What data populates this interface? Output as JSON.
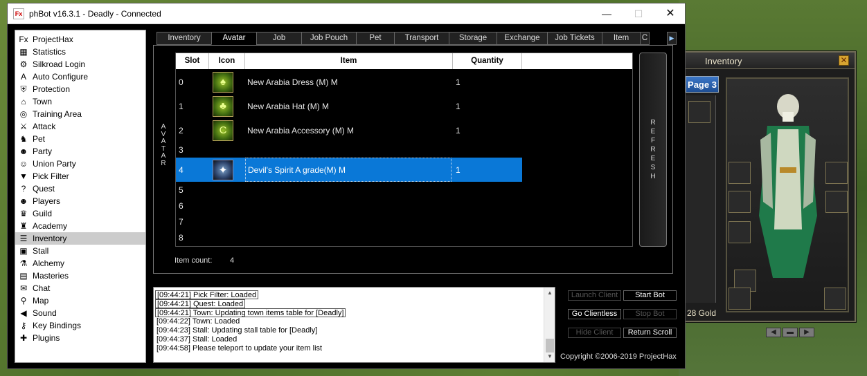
{
  "window": {
    "title": "phBot v16.3.1 - Deadly - Connected",
    "icon_text": "Fx",
    "minimize_label": "—",
    "maximize_label": "☐",
    "close_label": "✕"
  },
  "sidebar": {
    "items": [
      {
        "label": "ProjectHax",
        "icon": "projecthax-logo-icon",
        "glyph": "Fx"
      },
      {
        "label": "Statistics",
        "icon": "statistics-icon",
        "glyph": "▦"
      },
      {
        "label": "Silkroad Login",
        "icon": "login-icon",
        "glyph": "⚙"
      },
      {
        "label": "Auto Configure",
        "icon": "auto-configure-icon",
        "glyph": "A"
      },
      {
        "label": "Protection",
        "icon": "shield-icon",
        "glyph": "⛨"
      },
      {
        "label": "Town",
        "icon": "town-icon",
        "glyph": "⌂"
      },
      {
        "label": "Training Area",
        "icon": "training-area-icon",
        "glyph": "◎"
      },
      {
        "label": "Attack",
        "icon": "sword-icon",
        "glyph": "⚔"
      },
      {
        "label": "Pet",
        "icon": "pet-icon",
        "glyph": "♞"
      },
      {
        "label": "Party",
        "icon": "party-icon",
        "glyph": "☻"
      },
      {
        "label": "Union Party",
        "icon": "union-party-icon",
        "glyph": "☺"
      },
      {
        "label": "Pick Filter",
        "icon": "filter-icon",
        "glyph": "▼"
      },
      {
        "label": "Quest",
        "icon": "quest-icon",
        "glyph": "?"
      },
      {
        "label": "Players",
        "icon": "players-icon",
        "glyph": "☻"
      },
      {
        "label": "Guild",
        "icon": "guild-icon",
        "glyph": "♛"
      },
      {
        "label": "Academy",
        "icon": "academy-icon",
        "glyph": "♜"
      },
      {
        "label": "Inventory",
        "icon": "inventory-icon",
        "glyph": "☰"
      },
      {
        "label": "Stall",
        "icon": "stall-icon",
        "glyph": "▣"
      },
      {
        "label": "Alchemy",
        "icon": "alchemy-icon",
        "glyph": "⚗"
      },
      {
        "label": "Masteries",
        "icon": "masteries-icon",
        "glyph": "▤"
      },
      {
        "label": "Chat",
        "icon": "chat-icon",
        "glyph": "✉"
      },
      {
        "label": "Map",
        "icon": "map-pin-icon",
        "glyph": "⚲"
      },
      {
        "label": "Sound",
        "icon": "sound-icon",
        "glyph": "◀"
      },
      {
        "label": "Key Bindings",
        "icon": "key-icon",
        "glyph": "⚷"
      },
      {
        "label": "Plugins",
        "icon": "plugins-icon",
        "glyph": "✚"
      }
    ],
    "selected": "Inventory"
  },
  "tabs": [
    "Inventory",
    "Avatar",
    "Job",
    "Job Pouch",
    "Pet",
    "Transport",
    "Storage",
    "Exchange",
    "Job Tickets",
    "Item",
    "C"
  ],
  "active_tab": "Avatar",
  "tab_scroll_glyph": "▶",
  "panel": {
    "vertical_label": "A\nV\nA\nT\nA\nR",
    "columns": [
      "Slot",
      "Icon",
      "Item",
      "Quantity"
    ],
    "rows": [
      {
        "slot": "0",
        "icon": "dress-icon",
        "glyph": "♠",
        "item": "New Arabia Dress (M) M",
        "quantity": "1"
      },
      {
        "slot": "1",
        "icon": "hat-icon",
        "glyph": "♣",
        "item": "New Arabia Hat (M) M",
        "quantity": "1"
      },
      {
        "slot": "2",
        "icon": "accessory-icon",
        "glyph": "C",
        "item": "New Arabia Accessory (M) M",
        "quantity": "1"
      },
      {
        "slot": "3",
        "icon": "",
        "glyph": "",
        "item": "",
        "quantity": ""
      },
      {
        "slot": "4",
        "icon": "devil-spirit-icon",
        "glyph": "✦",
        "item": "Devil's Spirit A grade(M) M",
        "quantity": "1"
      },
      {
        "slot": "5",
        "icon": "",
        "glyph": "",
        "item": "",
        "quantity": ""
      },
      {
        "slot": "6",
        "icon": "",
        "glyph": "",
        "item": "",
        "quantity": ""
      },
      {
        "slot": "7",
        "icon": "",
        "glyph": "",
        "item": "",
        "quantity": ""
      },
      {
        "slot": "8",
        "icon": "",
        "glyph": "",
        "item": "",
        "quantity": ""
      }
    ],
    "selected_slot": "4",
    "refresh_label": "R\nE\nF\nR\nE\nS\nH",
    "item_count_label": "Item count:",
    "item_count_value": "4"
  },
  "log": {
    "lines": [
      "[09:44:21] Pick Filter: Loaded",
      "[09:44:21] Quest: Loaded",
      "[09:44:21] Town: Updating town items table for [Deadly]",
      "[09:44:22] Town: Loaded",
      "[09:44:23] Stall: Updating stall table for [Deadly]",
      "[09:44:37] Stall: Loaded",
      "[09:44:58] Please teleport to update your item list"
    ],
    "scroll_up": "▲",
    "scroll_down": "▼"
  },
  "controls": {
    "launch_client": "Launch Client",
    "start_bot": "Start Bot",
    "go_clientless": "Go Clientless",
    "stop_bot": "Stop Bot",
    "hide_client": "Hide Client",
    "return_scroll": "Return Scroll"
  },
  "copyright": "Copyright ©2006-2019 ProjectHax",
  "game": {
    "window_title": "Inventory",
    "close_glyph": "✕",
    "page_tab": "Page 3",
    "gold_text": "28 Gold",
    "prev_glyph": "◀",
    "mid_glyph": "▬",
    "next_glyph": "▶"
  },
  "colors": {
    "selection": "#0a78d7",
    "panel_bg": "#000000",
    "header_bg": "#ffffff",
    "accent_blue": "#2b6fc2"
  }
}
